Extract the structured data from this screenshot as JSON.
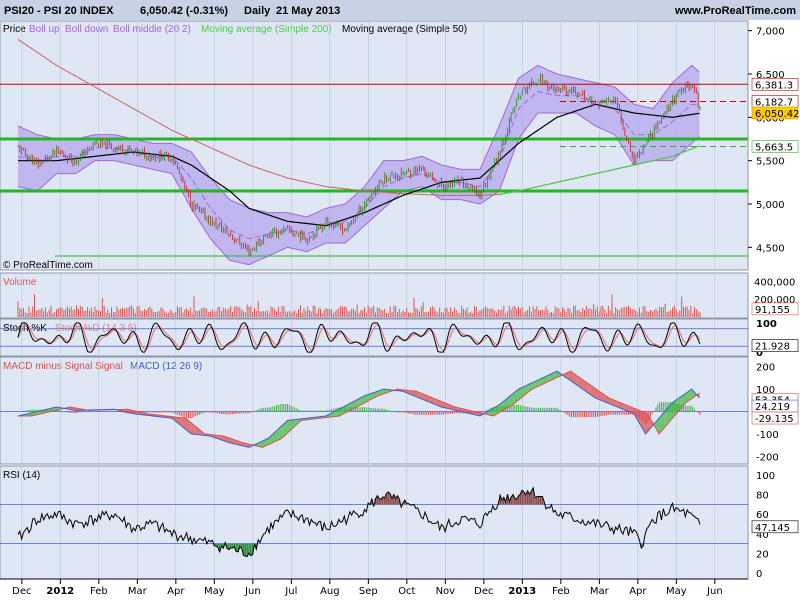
{
  "header": {
    "symbol": "PSI20 - PSI 20 INDEX",
    "quote": "6,050.42 (-0.31%)",
    "period": "Daily",
    "date": "21 May 2013",
    "site": "www.ProRealTime.com"
  },
  "watermark": "© ProRealTime.com",
  "colors": {
    "header_bg": "#c7d2e6",
    "pane_bg": "#dfe7f4",
    "frame": "#000000",
    "price": "#000000",
    "bollinger": "#a266d6",
    "bollinger_fill": "#b6a7ee",
    "ma200": "#4fc94f",
    "ma50": "#000000",
    "resistance": "#c00000",
    "support": "#27b427",
    "volume": "#e25555",
    "stoch_k": "#000000",
    "stoch_d": "#e88080",
    "macd_hist_pos": "#44b044",
    "macd_hist_neg": "#e05050",
    "macd_line": "#4060d0",
    "macd_signal": "#e05050",
    "rsi": "#000000",
    "rsi_over": "#8a4a4a",
    "rsi_under": "#2e8a3a"
  },
  "chart_data": [
    {
      "type": "line",
      "pane": "price",
      "title": "Price",
      "legend": [
        {
          "label": "Price",
          "color": "#000000"
        },
        {
          "label": "Boll up",
          "color": "#a266d6"
        },
        {
          "label": "Boll down",
          "color": "#a266d6"
        },
        {
          "label": "Boll middle (20 2)",
          "color": "#a266d6"
        },
        {
          "label": "Moving average (Simple 200)",
          "color": "#4fc94f"
        },
        {
          "label": "Moving average (Simple 50)",
          "color": "#000000"
        }
      ],
      "x_labels": [
        "Dec",
        "2012",
        "Feb",
        "Mar",
        "Apr",
        "May",
        "Jun",
        "Jul",
        "Aug",
        "Sep",
        "Oct",
        "Nov",
        "Dec",
        "2013",
        "Feb",
        "Mar",
        "Apr",
        "May",
        "Jun"
      ],
      "ylim": [
        4250,
        7100
      ],
      "y_ticks": [
        4500,
        5000,
        5500,
        6000,
        6500,
        7000
      ],
      "y_tick_labels": [
        "4,500",
        "5,000",
        "5,500",
        "6,000",
        "6,500",
        "7,000"
      ],
      "price_series": {
        "name": "Price",
        "months": [
          0,
          0.5,
          1,
          1.5,
          2,
          2.5,
          3,
          3.5,
          4,
          4.5,
          5,
          5.5,
          6,
          6.5,
          7,
          7.5,
          8,
          8.5,
          9,
          9.5,
          10,
          10.5,
          11,
          11.5,
          12,
          12.5,
          13,
          13.5,
          14,
          14.5,
          15,
          15.5,
          16,
          16.5,
          17,
          17.5,
          17.75
        ],
        "values": [
          5650,
          5450,
          5600,
          5500,
          5700,
          5650,
          5600,
          5550,
          5550,
          5000,
          4800,
          4650,
          4450,
          4650,
          4700,
          4600,
          4800,
          4700,
          5000,
          5300,
          5350,
          5400,
          5200,
          5250,
          5100,
          5600,
          6250,
          6450,
          6300,
          6300,
          6150,
          6200,
          5500,
          5850,
          6200,
          6400,
          6050
        ]
      },
      "bollinger": {
        "upper": [
          5900,
          5800,
          5750,
          5750,
          5800,
          5800,
          5750,
          5700,
          5700,
          5600,
          5300,
          5050,
          4950,
          4900,
          4900,
          4850,
          4950,
          5000,
          5200,
          5500,
          5500,
          5550,
          5450,
          5400,
          5400,
          5900,
          6450,
          6600,
          6500,
          6450,
          6400,
          6350,
          6150,
          6100,
          6400,
          6600,
          6500
        ],
        "lower": [
          5200,
          5150,
          5350,
          5350,
          5500,
          5500,
          5450,
          5400,
          5350,
          4950,
          4600,
          4350,
          4300,
          4400,
          4500,
          4450,
          4550,
          4550,
          4750,
          4950,
          5150,
          5200,
          5050,
          5050,
          5000,
          5150,
          5750,
          6050,
          6050,
          6050,
          5900,
          5800,
          5450,
          5500,
          5500,
          5700,
          5800
        ],
        "middle": [
          5550,
          5500,
          5550,
          5550,
          5650,
          5650,
          5600,
          5550,
          5550,
          5300,
          4950,
          4700,
          4600,
          4650,
          4700,
          4650,
          4750,
          4800,
          4950,
          5200,
          5300,
          5350,
          5250,
          5250,
          5200,
          5500,
          6100,
          6300,
          6250,
          6250,
          6150,
          6100,
          5800,
          5800,
          5950,
          6150,
          6150
        ]
      },
      "ma200": {
        "name": "Moving average (Simple 200)",
        "months": [
          0,
          1,
          2,
          3,
          4,
          5,
          6,
          7,
          8,
          9,
          10,
          11,
          12,
          12.5,
          13,
          14,
          15,
          16,
          17,
          17.75
        ],
        "values": [
          6900,
          6600,
          6350,
          6100,
          5850,
          5650,
          5450,
          5300,
          5200,
          5150,
          5120,
          5100,
          5100,
          5110,
          5150,
          5250,
          5350,
          5450,
          5550,
          5680
        ]
      },
      "ma50": {
        "name": "Moving average (Simple 50)",
        "months": [
          0,
          1,
          2,
          3,
          4,
          4.5,
          5,
          5.5,
          6,
          7,
          8,
          9,
          10,
          11,
          12,
          13,
          14,
          15,
          16,
          17,
          17.75
        ],
        "values": [
          5500,
          5500,
          5550,
          5600,
          5550,
          5450,
          5300,
          5150,
          4950,
          4800,
          4750,
          4900,
          5100,
          5250,
          5300,
          5700,
          6000,
          6150,
          6050,
          6000,
          6050
        ]
      },
      "levels": [
        {
          "value": 6381.3,
          "label": "6,381.3",
          "color": "#c00000",
          "style": "solid"
        },
        {
          "value": 6182.7,
          "label": "6,182.7",
          "color": "#c00000",
          "style": "dashed"
        },
        {
          "value": 6050.42,
          "label": "6,050.42",
          "color": "#000000",
          "style": "current"
        },
        {
          "value": 5663.5,
          "label": "5,663.5",
          "color": "#27b427",
          "style": "dashed"
        },
        {
          "value": 5750,
          "label": "",
          "color": "#27b427",
          "style": "solid"
        },
        {
          "value": 5150,
          "label": "",
          "color": "#27b427",
          "style": "solid"
        },
        {
          "value": 4400,
          "label": "",
          "color": "#27b427",
          "style": "thin"
        }
      ]
    },
    {
      "type": "bar",
      "pane": "volume",
      "title": "Volume",
      "ylim": [
        0,
        460000
      ],
      "y_tick_labels": [
        "400,000",
        "200,000"
      ],
      "y_ticks": [
        400000,
        200000
      ],
      "current_label": "91,155",
      "current_value": 91155
    },
    {
      "type": "line",
      "pane": "stochastic",
      "title": "Stoch %K",
      "title_extra": "Stoch %D (14 3 5)",
      "ylim": [
        -10,
        110
      ],
      "y_ticks": [
        100,
        0
      ],
      "y_tick_labels": [
        "100",
        "0"
      ],
      "levels": [
        80,
        20
      ],
      "current_label": "21.928",
      "current_value": 21.928
    },
    {
      "type": "line",
      "pane": "macd",
      "title": "MACD minus Signal",
      "title_extra_1": "Signal",
      "title_extra_2": "MACD (12 26 9)",
      "ylim": [
        -230,
        230
      ],
      "y_ticks": [
        200,
        100,
        0,
        -100,
        -200
      ],
      "y_tick_labels": [
        "200",
        "100",
        "0",
        "-100",
        "-200"
      ],
      "current_labels": [
        {
          "value": 53.354,
          "label": "53.354",
          "color": "#e05050"
        },
        {
          "value": 24.219,
          "label": "24.219",
          "color": "#4060d0"
        },
        {
          "value": -29.135,
          "label": "-29.135",
          "color": "#e05050"
        }
      ]
    },
    {
      "type": "line",
      "pane": "rsi",
      "title": "RSI (14)",
      "ylim": [
        -5,
        105
      ],
      "y_ticks": [
        100,
        80,
        60,
        40,
        20,
        0
      ],
      "y_tick_labels": [
        "100",
        "80",
        "60",
        "40",
        "20",
        "0"
      ],
      "levels": [
        70,
        30
      ],
      "current_label": "47.145",
      "current_value": 47.145
    }
  ]
}
